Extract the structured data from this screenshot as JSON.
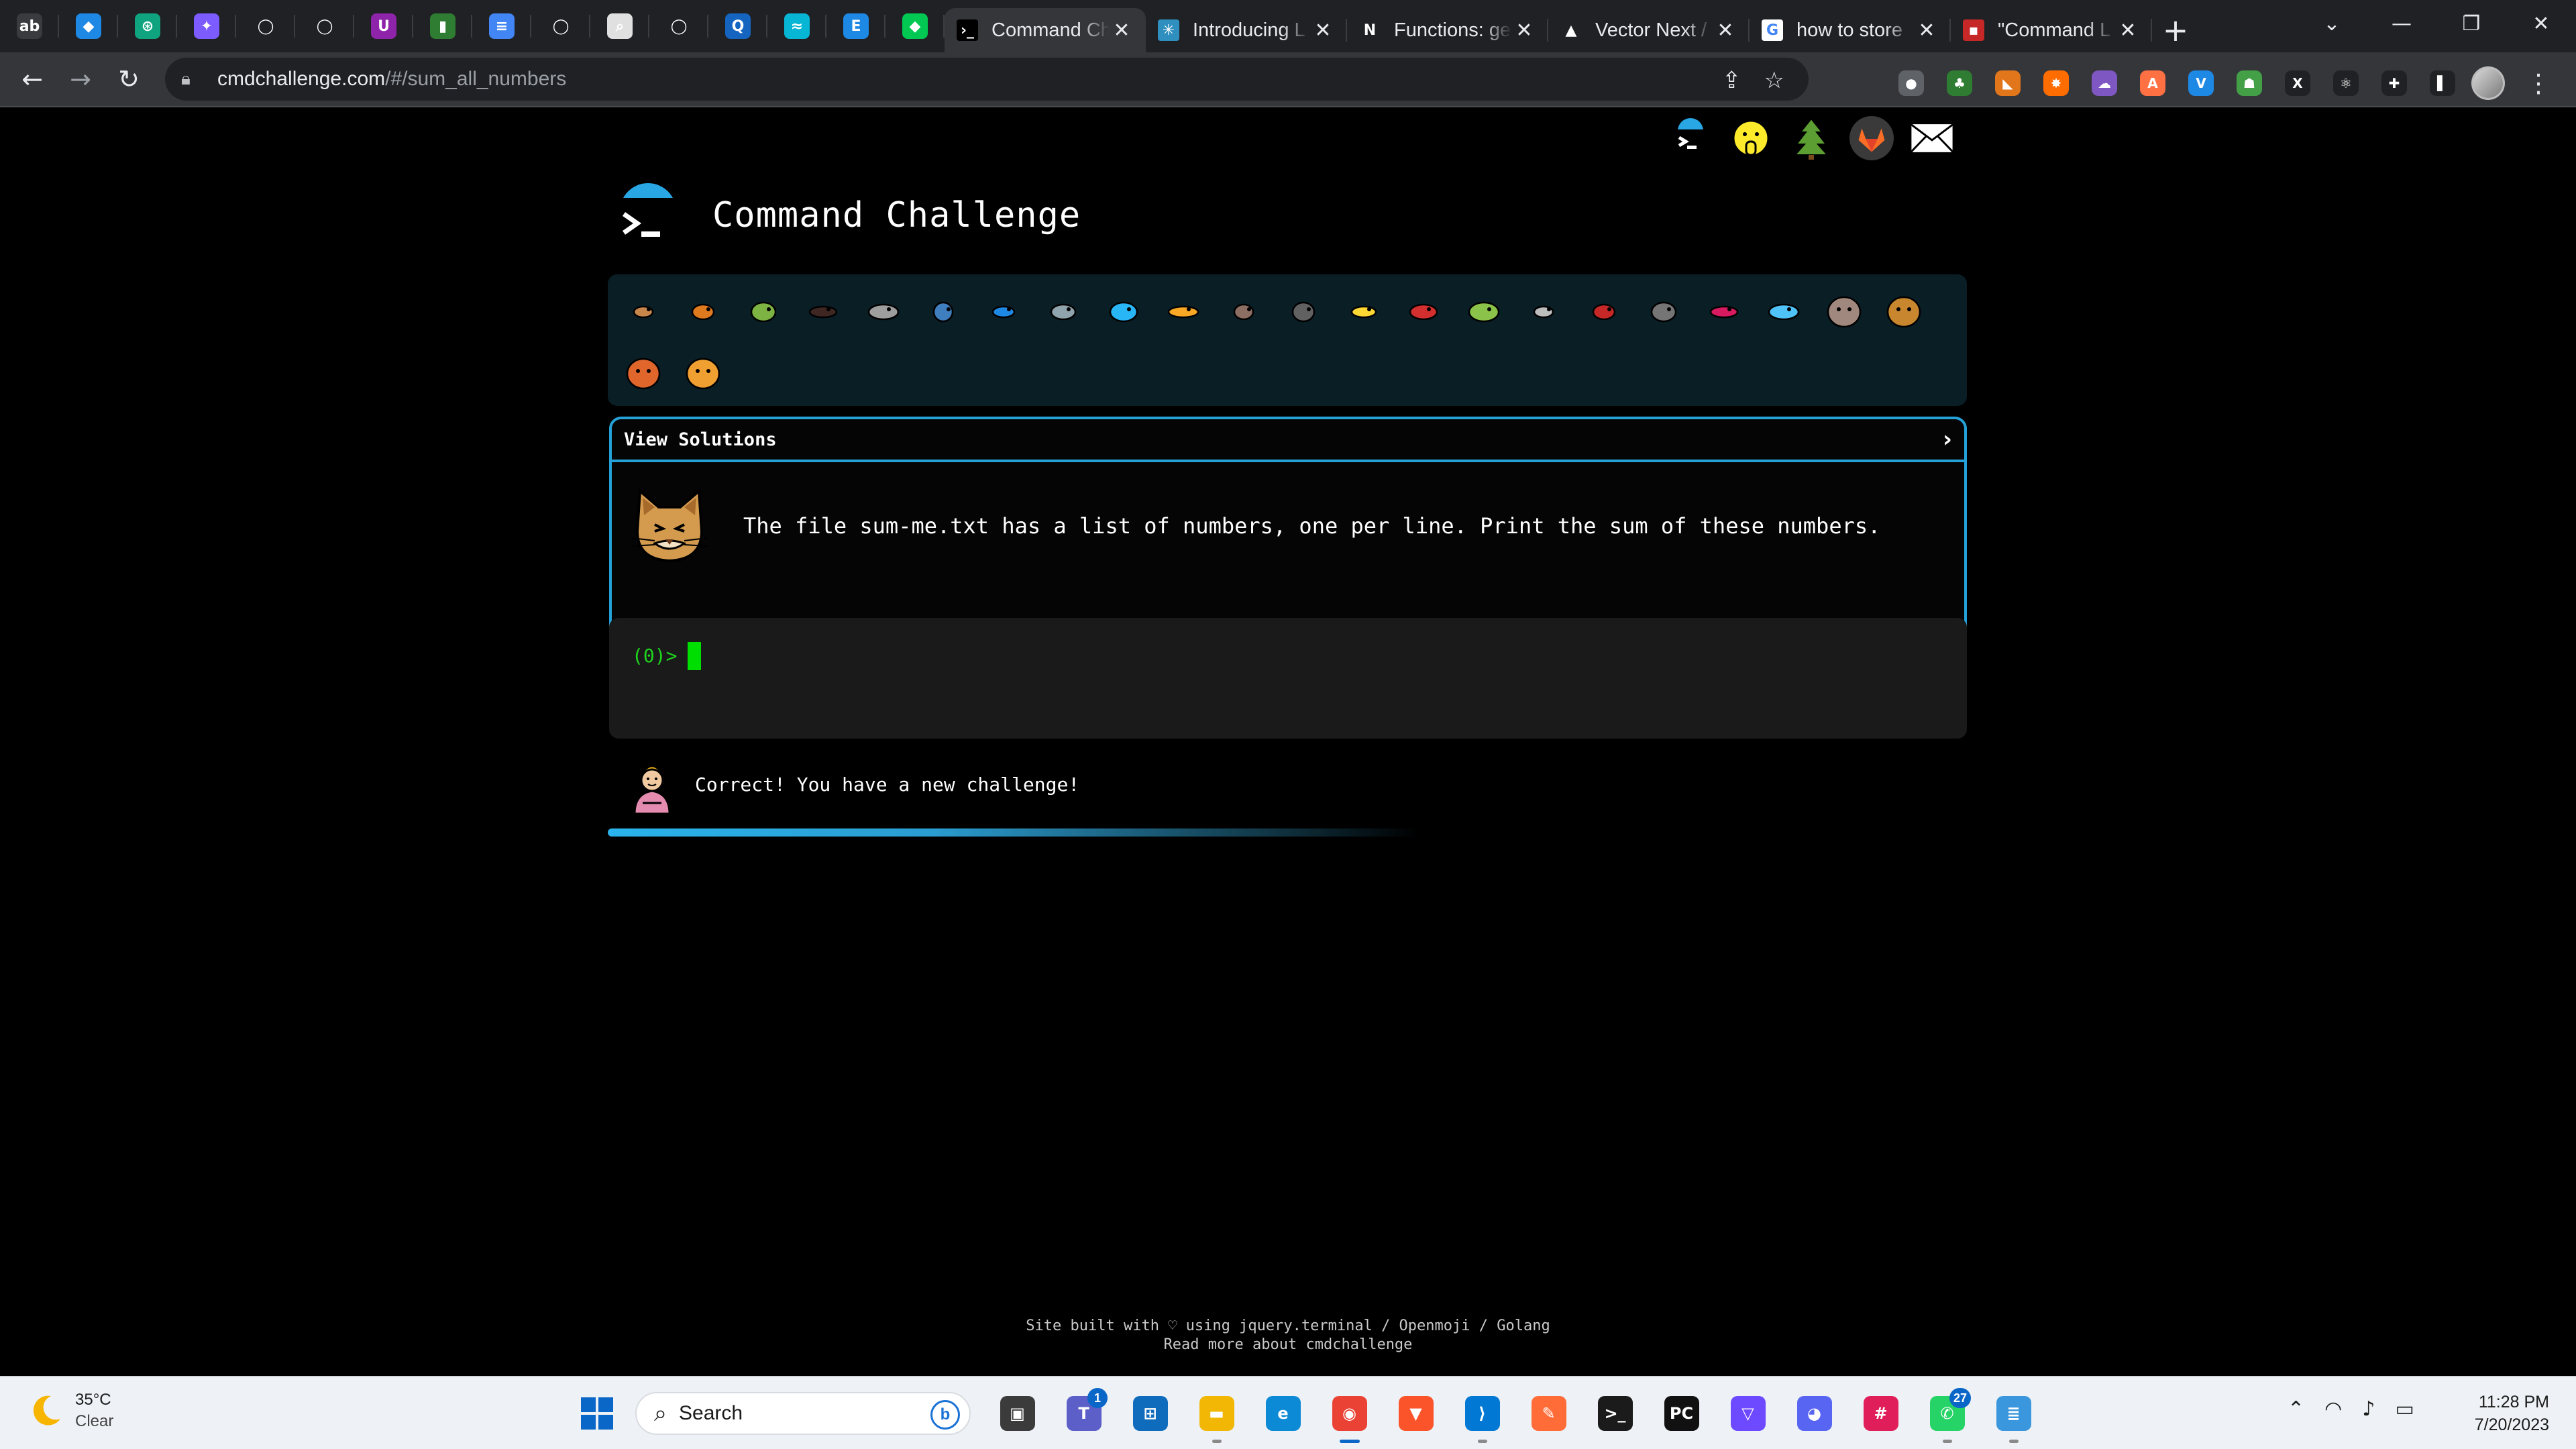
{
  "browser": {
    "pinned_tabs": [
      {
        "icon": "adobe-icon",
        "color": "#3a3b3e",
        "glyph": "ab"
      },
      {
        "icon": "brain-icon",
        "color": "#1e88e5",
        "glyph": "◆"
      },
      {
        "icon": "openai-icon",
        "color": "#10a37f",
        "glyph": "⊛"
      },
      {
        "icon": "sparkle-icon",
        "color": "#7c5cff",
        "glyph": "✦"
      },
      {
        "icon": "github-icon",
        "color": "#202124",
        "glyph": "◯"
      },
      {
        "icon": "github-icon",
        "color": "#202124",
        "glyph": "◯"
      },
      {
        "icon": "purple-u-icon",
        "color": "#8e24aa",
        "glyph": "U"
      },
      {
        "icon": "cylinder-icon",
        "color": "#2e7d32",
        "glyph": "▮"
      },
      {
        "icon": "docs-icon",
        "color": "#4285f4",
        "glyph": "≡"
      },
      {
        "icon": "github-icon",
        "color": "#202124",
        "glyph": "◯"
      },
      {
        "icon": "search-doc-icon",
        "color": "#e0e0e0",
        "glyph": "⌕"
      },
      {
        "icon": "github-icon",
        "color": "#202124",
        "glyph": "◯"
      },
      {
        "icon": "blue-q-icon",
        "color": "#1565c0",
        "glyph": "Q"
      },
      {
        "icon": "tailwind-icon",
        "color": "#06b6d4",
        "glyph": "≈"
      },
      {
        "icon": "e-icon",
        "color": "#1e88e5",
        "glyph": "E"
      },
      {
        "icon": "leaf-icon",
        "color": "#00c853",
        "glyph": "◆"
      }
    ],
    "tabs": [
      {
        "title": "Command Ch",
        "active": true,
        "fav_glyph": "›_",
        "fav_color": "#000000"
      },
      {
        "title": "Introducing L",
        "active": false,
        "fav_glyph": "✳",
        "fav_color": "#2f8fbf"
      },
      {
        "title": "Functions: ge",
        "active": false,
        "fav_glyph": "N",
        "fav_color": "#202124"
      },
      {
        "title": "Vector Next /",
        "active": false,
        "fav_glyph": "▲",
        "fav_color": "#202124"
      },
      {
        "title": "how to store",
        "active": false,
        "fav_glyph": "G",
        "fav_color": "#ffffff"
      },
      {
        "title": "\"Command L",
        "active": false,
        "fav_glyph": "▪",
        "fav_color": "#c62828"
      }
    ],
    "new_tab_label": "+",
    "url_host": "cmdchallenge.com",
    "url_path": "/#/sum_all_numbers",
    "extensions": [
      {
        "icon": "grey-dot-icon",
        "color": "#5f6368",
        "glyph": "●"
      },
      {
        "icon": "tree-icon",
        "color": "#2e7d32",
        "glyph": "♣"
      },
      {
        "icon": "metamask-icon",
        "color": "#e2761b",
        "glyph": "◣"
      },
      {
        "icon": "burst-icon",
        "color": "#ff6d00",
        "glyph": "✸"
      },
      {
        "icon": "cloud-icon",
        "color": "#7e57c2",
        "glyph": "☁"
      },
      {
        "icon": "a-icon",
        "color": "#ff7043",
        "glyph": "A"
      },
      {
        "icon": "v-icon",
        "color": "#1e88e5",
        "glyph": "V"
      },
      {
        "icon": "people-icon",
        "color": "#43a047",
        "glyph": "☗"
      },
      {
        "icon": "excel-icon",
        "color": "#202124",
        "glyph": "X"
      },
      {
        "icon": "react-icon",
        "color": "#202124",
        "glyph": "⚛"
      },
      {
        "icon": "puzzle-icon",
        "color": "#202124",
        "glyph": "✚"
      },
      {
        "icon": "sidepanel-icon",
        "color": "#202124",
        "glyph": "▌"
      }
    ]
  },
  "site": {
    "title": "Command Challenge",
    "top_links": [
      {
        "icon": "cmdchallenge-icon"
      },
      {
        "icon": "whispering-face-icon"
      },
      {
        "icon": "tree-icon"
      },
      {
        "icon": "gitlab-icon"
      },
      {
        "icon": "mail-icon"
      }
    ],
    "animals": [
      "snail-icon",
      "butterfly-icon",
      "caterpillar-icon",
      "ant-icon",
      "shell-icon",
      "whale-icon",
      "dolphin-icon",
      "shark-icon",
      "fish-icon",
      "tropical-fish-icon",
      "pufferfish-icon",
      "wolf-icon",
      "bee-icon",
      "ladybug-icon",
      "worm-icon",
      "mosquito-icon",
      "scorpion-icon",
      "fly-icon",
      "earthworm-icon",
      "microbe-icon",
      "monkey-icon",
      "dog-icon",
      "fox-icon",
      "cat-icon"
    ],
    "solutions_label": "View Solutions",
    "challenge_text": "The file sum-me.txt has a list of numbers, one per line. Print the sum of these numbers.",
    "prompt": "(0)>",
    "status_text": "Correct! You have a new challenge!",
    "progress": 0.5,
    "footer_line1": "Site built with ♡ using jquery.terminal / Openmoji / Golang",
    "footer_line2": "Read more about cmdchallenge"
  },
  "taskbar": {
    "temperature": "35°C",
    "condition": "Clear",
    "search_placeholder": "Search",
    "apps": [
      {
        "icon": "task-view-icon",
        "color": "#3b3b3b",
        "glyph": "▣",
        "running": false
      },
      {
        "icon": "teams-icon",
        "color": "#5b5fc7",
        "glyph": "T",
        "badge": "1",
        "running": false
      },
      {
        "icon": "store-icon",
        "color": "#0f6cbd",
        "glyph": "⊞",
        "running": false
      },
      {
        "icon": "file-explorer-icon",
        "color": "#f2b705",
        "glyph": "▬",
        "running": true
      },
      {
        "icon": "edge-icon",
        "color": "#0c8ad6",
        "glyph": "e",
        "running": false
      },
      {
        "icon": "chrome-icon",
        "color": "#ea4335",
        "glyph": "◉",
        "running": true,
        "active": true
      },
      {
        "icon": "brave-icon",
        "color": "#fb542b",
        "glyph": "▼",
        "running": false
      },
      {
        "icon": "vscode-icon",
        "color": "#0078d4",
        "glyph": "⟩",
        "running": true
      },
      {
        "icon": "postman-icon",
        "color": "#ff6c37",
        "glyph": "✎",
        "running": false
      },
      {
        "icon": "terminal-icon",
        "color": "#1b1b1b",
        "glyph": ">_",
        "running": false
      },
      {
        "icon": "pycharm-icon",
        "color": "#111111",
        "glyph": "PC",
        "running": false
      },
      {
        "icon": "proton-vpn-icon",
        "color": "#6d4aff",
        "glyph": "▽",
        "running": false
      },
      {
        "icon": "discord-icon",
        "color": "#5865f2",
        "glyph": "◕",
        "running": false
      },
      {
        "icon": "slack-icon",
        "color": "#e01e5a",
        "glyph": "#",
        "running": false
      },
      {
        "icon": "whatsapp-icon",
        "color": "#25d366",
        "glyph": "✆",
        "badge": "27",
        "running": true
      },
      {
        "icon": "notepad-icon",
        "color": "#3a96dd",
        "glyph": "≣",
        "running": true
      }
    ],
    "time": "11:28 PM",
    "date": "7/20/2023"
  }
}
